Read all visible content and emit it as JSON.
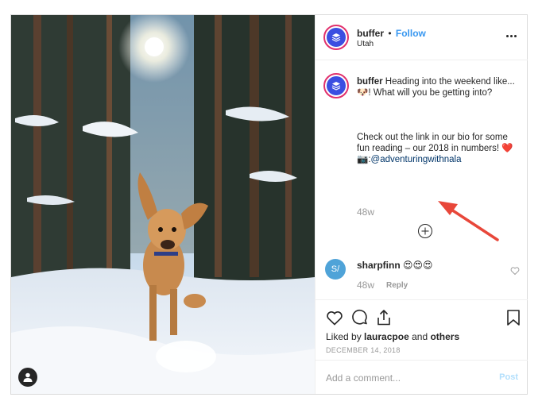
{
  "post": {
    "username": "buffer",
    "separator": "•",
    "follow_label": "Follow",
    "location": "Utah",
    "more_icon": "ellipsis-icon",
    "photo_alt": "",
    "caption": {
      "username": "buffer",
      "line1": "Heading into the weekend like...🐶! What will you be getting into?",
      "line2": "Check out the link in our bio for some fun reading – our 2018 in numbers! ❤️",
      "credit_prefix": "📷:",
      "mention": "@adventuringwithnala",
      "time": "48w"
    },
    "comments": [
      {
        "avatar_initials": "S/",
        "username": "sharpfinn",
        "text": "😍😍😍",
        "time": "48w",
        "reply_label": "Reply"
      }
    ],
    "actions": {
      "likes_prefix": "Liked by",
      "likes_user": "lauracpoe",
      "likes_and": "and",
      "likes_others": "others",
      "date": "DECEMBER 14, 2018"
    },
    "add_comment": {
      "placeholder": "Add a comment...",
      "post_label": "Post"
    }
  },
  "colors": {
    "follow": "#3897f0",
    "brand_avatar": "#3b4ee1",
    "arrow": "#e8473a",
    "post_disabled": "#b2dffc"
  }
}
